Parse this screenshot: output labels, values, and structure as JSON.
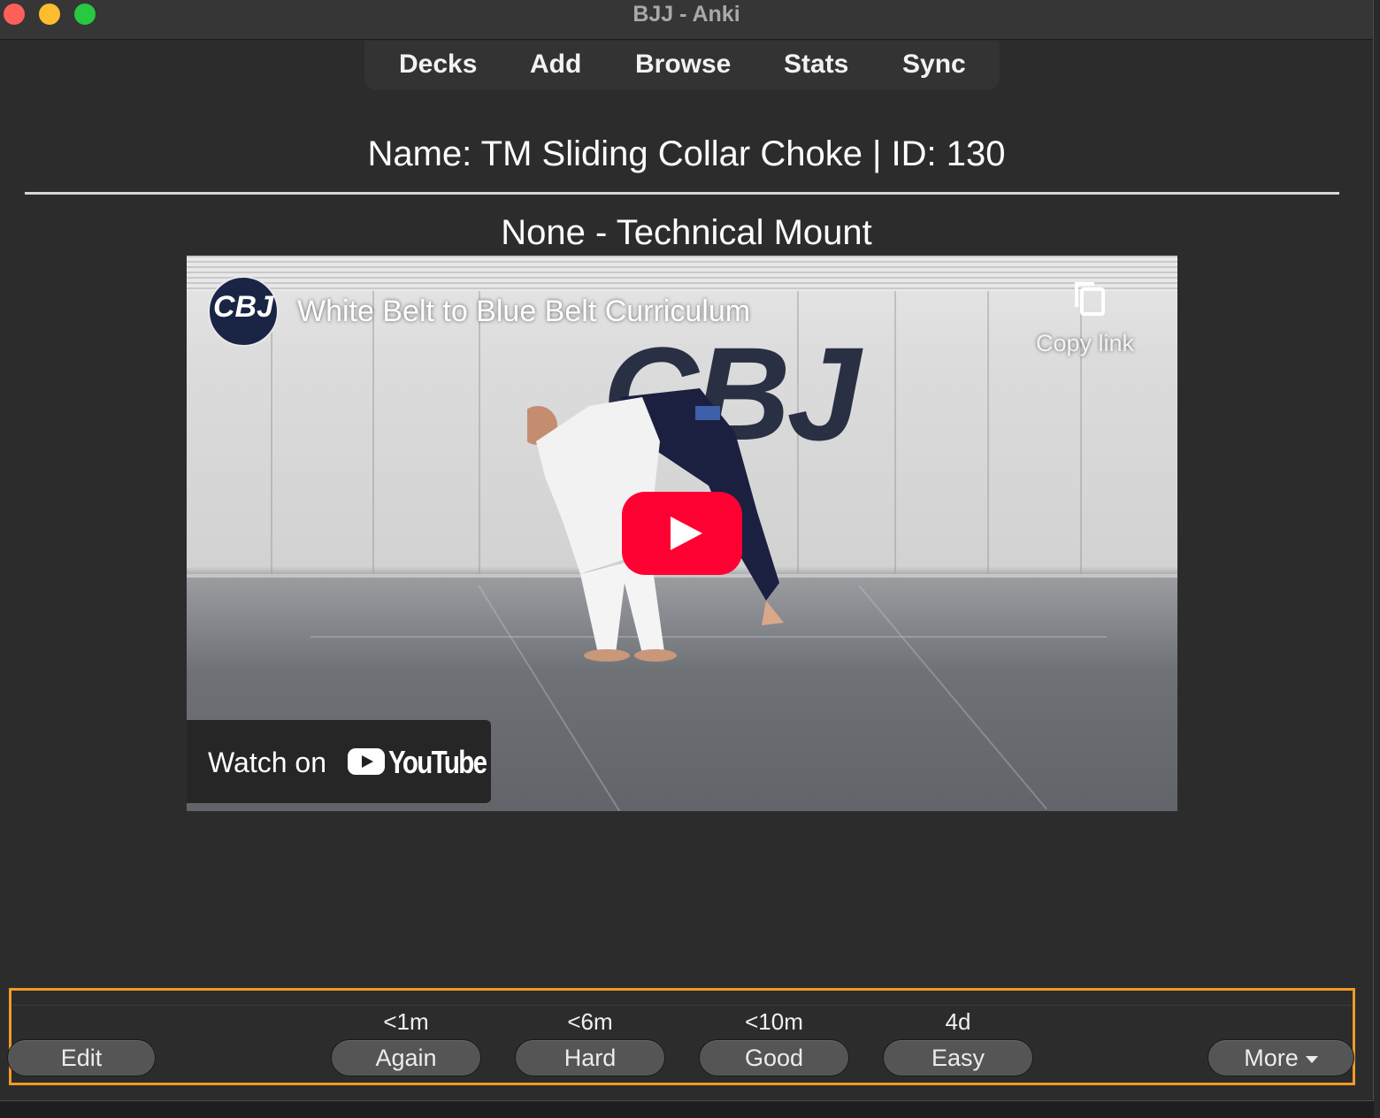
{
  "window": {
    "title": "BJJ - Anki"
  },
  "toolbar": {
    "items": [
      "Decks",
      "Add",
      "Browse",
      "Stats",
      "Sync"
    ]
  },
  "card": {
    "name_line": "Name: TM Sliding Collar Choke | ID: 130",
    "subtitle": "None - Technical Mount"
  },
  "video": {
    "channel_badge": "CBJ",
    "wall_logo": "CBJ",
    "title": "White Belt to Blue Belt Curriculum",
    "copy_link_label": "Copy link",
    "watch_on_label": "Watch on",
    "youtube_wordmark": "YouTube",
    "icons": [
      "copy-icon",
      "play-icon",
      "youtube-logo-icon"
    ]
  },
  "review_bar": {
    "edit_label": "Edit",
    "more_label": "More",
    "answers": [
      {
        "interval": "<1m",
        "label": "Again"
      },
      {
        "interval": "<6m",
        "label": "Hard"
      },
      {
        "interval": "<10m",
        "label": "Good"
      },
      {
        "interval": "4d",
        "label": "Easy"
      }
    ],
    "highlight_color": "#f09a27"
  },
  "colors": {
    "window_bg": "#2c2c2c",
    "button_bg": "#555555",
    "play_button": "#ff0033"
  }
}
